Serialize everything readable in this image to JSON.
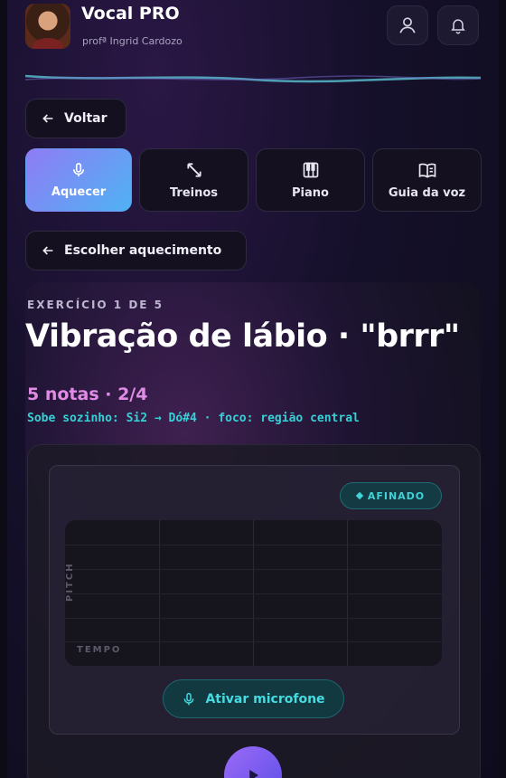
{
  "header": {
    "app_title": "Vocal PRO",
    "teacher": "profª Ingrid Cardozo",
    "user_icon": "user-icon",
    "bell_icon": "bell-icon"
  },
  "nav": {
    "back_label": "Voltar",
    "tabs": [
      {
        "label": "Aquecer",
        "icon": "microphone-icon",
        "active": true
      },
      {
        "label": "Treinos",
        "icon": "arrows-diagonal-icon",
        "active": false
      },
      {
        "label": "Piano",
        "icon": "piano-icon",
        "active": false
      },
      {
        "label": "Guia da voz",
        "icon": "book-icon",
        "active": false
      }
    ],
    "choose_warmup_label": "Escolher aquecimento"
  },
  "exercise": {
    "counter": "EXERCÍCIO 1 DE 5",
    "title": "Vibração de lábio · \"brrr\"",
    "notes": "5 notas · 2/4",
    "range": "Sobe sozinho: Si2 → Dó#4 · foco: região central",
    "status_badge": "AFINADO",
    "axis_pitch": "PITCH",
    "axis_time": "TEMPO",
    "mic_button_label": "Ativar microfone"
  },
  "colors": {
    "accent_start": "#8f7cf5",
    "accent_end": "#4fb2f4",
    "teal": "#35d1d6",
    "pink": "#e08be6"
  }
}
